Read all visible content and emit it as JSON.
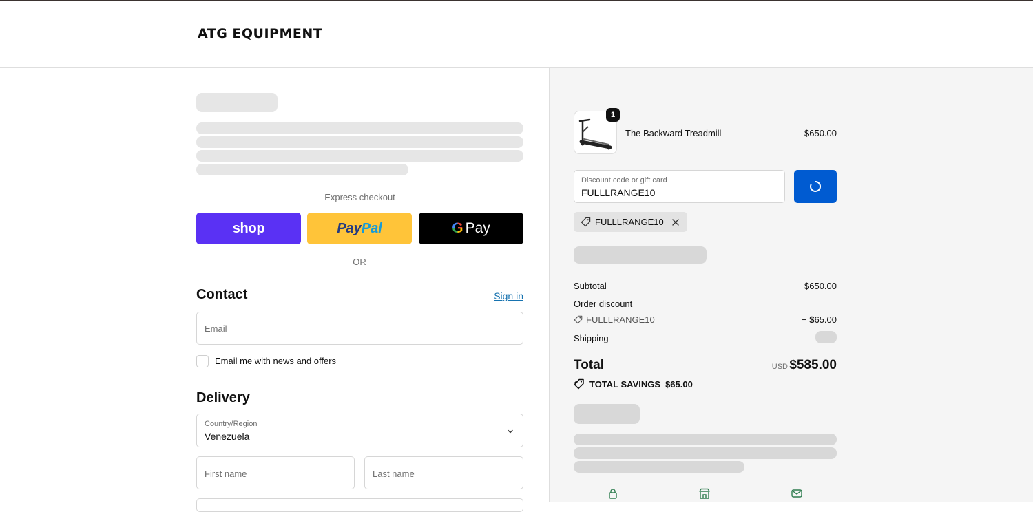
{
  "header": {
    "logo": "ATG EQUIPMENT"
  },
  "express": {
    "label": "Express checkout",
    "shop_label": "shop",
    "paypal_part1": "Pay",
    "paypal_part2": "Pal",
    "gpay_g": "G",
    "gpay_label": "Pay",
    "or_label": "OR"
  },
  "contact": {
    "heading": "Contact",
    "sign_in": "Sign in",
    "email_placeholder": "Email",
    "newsletter_label": "Email me with news and offers"
  },
  "delivery": {
    "heading": "Delivery",
    "country_label": "Country/Region",
    "country_value": "Venezuela",
    "first_name_placeholder": "First name",
    "last_name_placeholder": "Last name"
  },
  "summary": {
    "item": {
      "quantity": "1",
      "name": "The Backward Treadmill",
      "price": "$650.00"
    },
    "discount_field_label": "Discount code or gift card",
    "discount_field_value": "FULLLRANGE10",
    "applied_code": "FULLLRANGE10",
    "subtotal_label": "Subtotal",
    "subtotal_value": "$650.00",
    "order_discount_label": "Order discount",
    "discount_code": "FULLLRANGE10",
    "discount_value": "− $65.00",
    "shipping_label": "Shipping",
    "total_label": "Total",
    "currency": "USD",
    "total_value": "$585.00",
    "savings_label": "TOTAL SAVINGS",
    "savings_value": "$65.00"
  },
  "colors": {
    "shop": "#5a31f4",
    "paypal": "#ffc439",
    "gpay": "#000000",
    "apply_button": "#005bd1",
    "link": "#1773b0",
    "footer_icons": "#2e7d4f"
  },
  "icons": [
    "tag-icon",
    "close-icon",
    "spinner-icon",
    "chevron-down-icon",
    "lock-icon",
    "store-icon",
    "mail-icon"
  ]
}
